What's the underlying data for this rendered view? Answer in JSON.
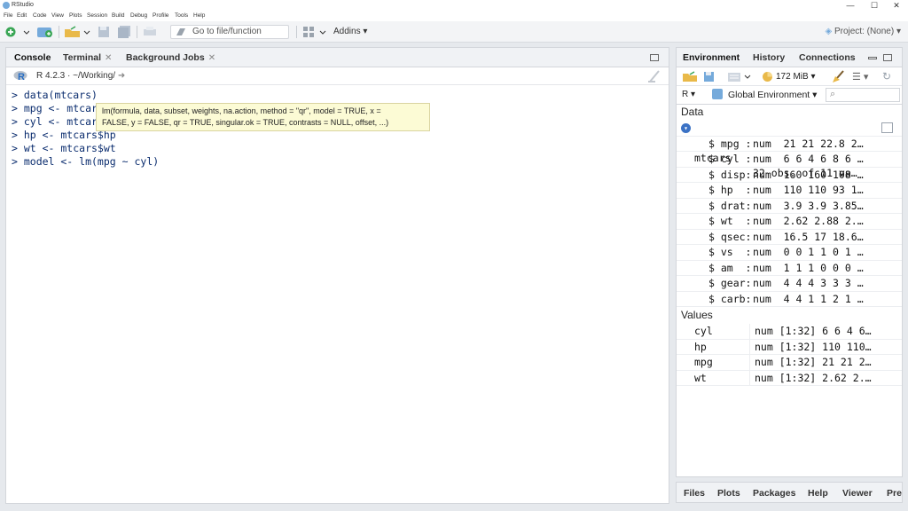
{
  "window": {
    "title": "RStudio",
    "controls": [
      "—",
      "☐",
      "✕"
    ]
  },
  "menu": [
    "File",
    "Edit",
    "Code",
    "View",
    "Plots",
    "Session",
    "Build",
    "Debug",
    "Profile",
    "Tools",
    "Help"
  ],
  "toolbar": {
    "goto_placeholder": "Go to file/function",
    "addins_label": "Addins",
    "project_label": "Project: (None)"
  },
  "console_pane": {
    "tabs": [
      {
        "label": "Console",
        "closable": false
      },
      {
        "label": "Terminal",
        "closable": true
      },
      {
        "label": "Background Jobs",
        "closable": true
      }
    ],
    "r_version": "R 4.2.3",
    "working_dir": "~/Working/",
    "lines": [
      "> data(mtcars)",
      "> mpg <- mtcars$mpg",
      "> cyl <- mtcars$cyl",
      "> hp <- mtcars$hp",
      "> wt <- mtcars$wt",
      "> model <- lm(mpg ~ cyl"
    ],
    "tooltip_line1": "lm(formula, data, subset, weights, na.action, method = \"qr\", model = TRUE, x =",
    "tooltip_line2": "FALSE, y = FALSE, qr = TRUE, singular.ok = TRUE, contrasts = NULL, offset, ...)"
  },
  "env_pane": {
    "tabs": [
      "Environment",
      "History",
      "Connections"
    ],
    "memory": "172 MiB",
    "lang": "R",
    "scope": "Global Environment",
    "data_header": "Data",
    "values_header": "Values",
    "dataset": {
      "name": "mtcars",
      "desc": "32 obs. of 11 va…"
    },
    "columns": [
      {
        "name": "$ mpg :",
        "desc": "num  21 21 22.8 2…"
      },
      {
        "name": "$ cyl :",
        "desc": "num  6 6 4 6 8 6 …"
      },
      {
        "name": "$ disp:",
        "desc": "num  160 160 108 …"
      },
      {
        "name": "$ hp  :",
        "desc": "num  110 110 93 1…"
      },
      {
        "name": "$ drat:",
        "desc": "num  3.9 3.9 3.85…"
      },
      {
        "name": "$ wt  :",
        "desc": "num  2.62 2.88 2.…"
      },
      {
        "name": "$ qsec:",
        "desc": "num  16.5 17 18.6…"
      },
      {
        "name": "$ vs  :",
        "desc": "num  0 0 1 1 0 1 …"
      },
      {
        "name": "$ am  :",
        "desc": "num  1 1 1 0 0 0 …"
      },
      {
        "name": "$ gear:",
        "desc": "num  4 4 4 3 3 3 …"
      },
      {
        "name": "$ carb:",
        "desc": "num  4 4 1 1 2 1 …"
      }
    ],
    "values": [
      {
        "name": "cyl",
        "desc": "num [1:32] 6 6 4 6…"
      },
      {
        "name": "hp",
        "desc": "num [1:32] 110 110…"
      },
      {
        "name": "mpg",
        "desc": "num [1:32] 21 21 2…"
      },
      {
        "name": "wt",
        "desc": "num [1:32] 2.62 2.…"
      }
    ]
  },
  "files_pane": {
    "tabs": [
      "Files",
      "Plots",
      "Packages",
      "Help",
      "Viewer",
      "Pre"
    ]
  },
  "colors": {
    "accent": "#75aadb",
    "console_text": "#0a2c6e",
    "tooltip_bg": "#fcfbd5"
  }
}
